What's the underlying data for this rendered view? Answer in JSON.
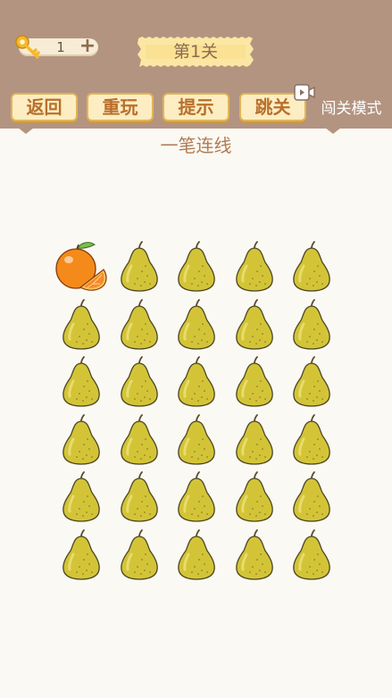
{
  "hud": {
    "key_count": "1",
    "level_title": "第1关"
  },
  "buttons": {
    "back": "返回",
    "replay": "重玩",
    "hint": "提示",
    "skip": "跳关",
    "challenge_mode": "闯关模式"
  },
  "subtitle": "一笔连线",
  "board": {
    "rows": 6,
    "cols": 5,
    "cells": [
      [
        "orange",
        "pear",
        "pear",
        "pear",
        "pear"
      ],
      [
        "pear",
        "pear",
        "pear",
        "pear",
        "pear"
      ],
      [
        "pear",
        "pear",
        "pear",
        "pear",
        "pear"
      ],
      [
        "pear",
        "pear",
        "pear",
        "pear",
        "pear"
      ],
      [
        "pear",
        "pear",
        "pear",
        "pear",
        "pear"
      ],
      [
        "pear",
        "pear",
        "pear",
        "pear",
        "pear"
      ]
    ]
  },
  "colors": {
    "header": "#b39481",
    "button_fill": "#fcedc2",
    "button_text": "#b86f2b",
    "pear": "#d3c437",
    "orange": "#f48a1a"
  }
}
